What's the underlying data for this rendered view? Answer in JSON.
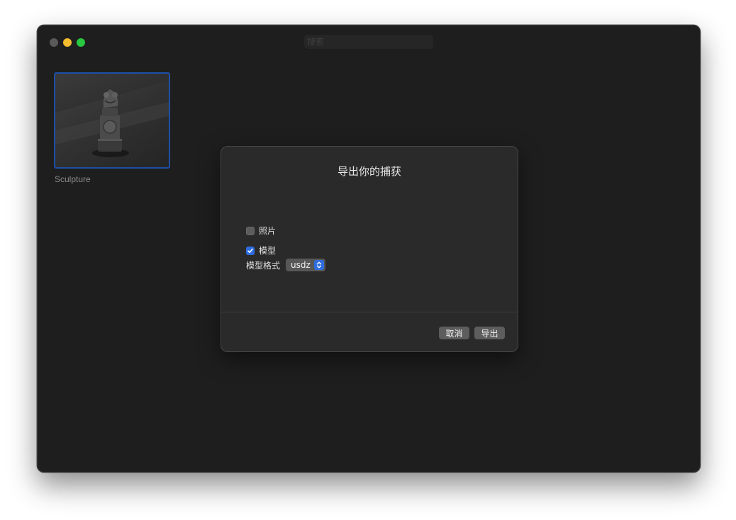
{
  "window": {
    "search_placeholder": "搜索"
  },
  "gallery": {
    "items": [
      {
        "label": "Sculpture",
        "selected": true
      }
    ]
  },
  "dialog": {
    "title": "导出你的捕获",
    "options": {
      "photos_label": "照片",
      "photos_checked": false,
      "model_label": "模型",
      "model_checked": true
    },
    "format": {
      "label": "模型格式",
      "selected": "usdz"
    },
    "buttons": {
      "cancel": "取消",
      "export": "导出"
    }
  },
  "colors": {
    "accent": "#2e6de0",
    "selection_border": "#1c4fa8",
    "window_bg": "#1e1e1e",
    "dialog_bg": "#2a2a2a"
  }
}
